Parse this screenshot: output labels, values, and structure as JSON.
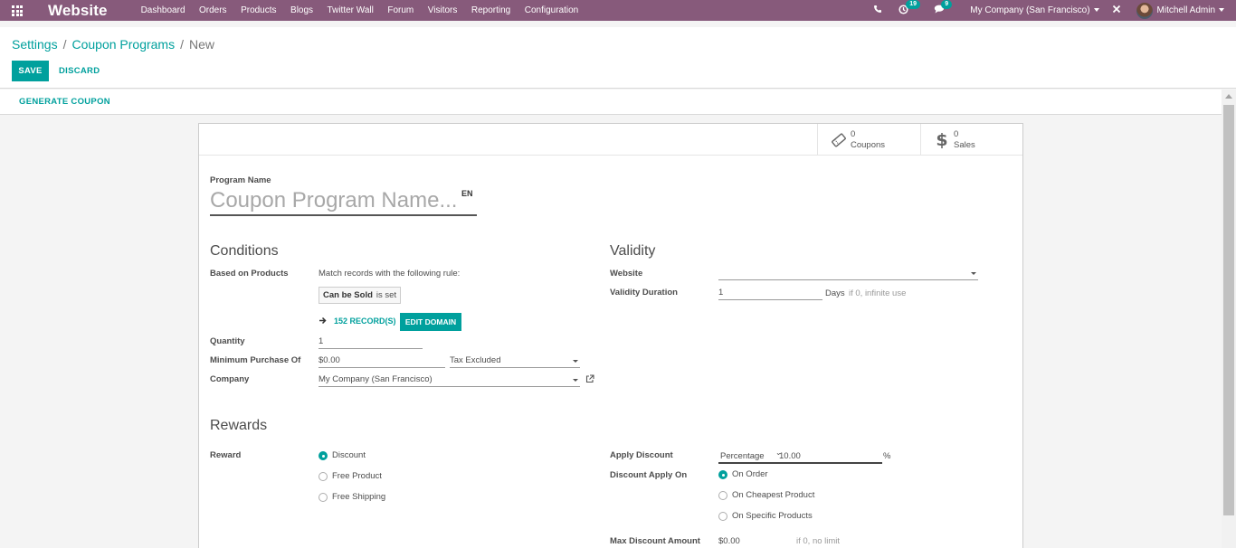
{
  "navbar": {
    "brand": "Website",
    "menu": [
      "Dashboard",
      "Orders",
      "Products",
      "Blogs",
      "Twitter Wall",
      "Forum",
      "Visitors",
      "Reporting",
      "Configuration"
    ],
    "activity_count": "19",
    "messages_count": "9",
    "company": "My Company (San Francisco)",
    "user": "Mitchell Admin"
  },
  "breadcrumb": {
    "items": [
      "Settings",
      "Coupon Programs"
    ],
    "separator": "/",
    "current": "New"
  },
  "buttons": {
    "save": "SAVE",
    "discard": "DISCARD",
    "generate_coupon": "GENERATE COUPON"
  },
  "stat_buttons": {
    "coupons": {
      "value": "0",
      "label": "Coupons"
    },
    "sales": {
      "value": "0",
      "label": "Sales"
    }
  },
  "program": {
    "label": "Program Name",
    "placeholder": "Coupon Program Name...",
    "lang": "EN"
  },
  "conditions": {
    "title": "Conditions",
    "based_on_products": {
      "label": "Based on Products",
      "rule_text": "Match records with the following rule:",
      "tag_field": "Can be Sold",
      "tag_op": "is set",
      "records": "152 RECORD(S)",
      "edit_domain": "EDIT DOMAIN"
    },
    "quantity": {
      "label": "Quantity",
      "value": "1"
    },
    "minimum_purchase": {
      "label": "Minimum Purchase Of",
      "value": "$0.00",
      "tax": "Tax Excluded"
    },
    "company": {
      "label": "Company",
      "value": "My Company (San Francisco)"
    }
  },
  "validity": {
    "title": "Validity",
    "website": {
      "label": "Website",
      "value": ""
    },
    "duration": {
      "label": "Validity Duration",
      "value": "1",
      "unit": "Days",
      "hint": "if 0, infinite use"
    }
  },
  "rewards": {
    "title": "Rewards",
    "reward": {
      "label": "Reward",
      "options": [
        "Discount",
        "Free Product",
        "Free Shipping"
      ],
      "selected": 0
    },
    "apply_discount": {
      "label": "Apply Discount",
      "type": "Percentage",
      "value": "10.00",
      "unit": "%"
    },
    "discount_apply_on": {
      "label": "Discount Apply On",
      "options": [
        "On Order",
        "On Cheapest Product",
        "On Specific Products"
      ],
      "selected": 0
    },
    "max_discount": {
      "label": "Max Discount Amount",
      "value": "$0.00",
      "hint": "if 0, no limit"
    }
  },
  "colors": {
    "navbar": "#875a7b",
    "accent": "#00a09d"
  }
}
